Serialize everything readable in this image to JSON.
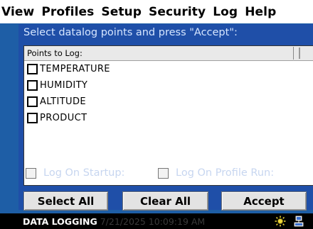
{
  "menu": [
    "View",
    "Profiles",
    "Setup",
    "Security",
    "Log",
    "Help"
  ],
  "prompt": "Select datalog points and press \"Accept\":",
  "list": {
    "header": "Points to Log:",
    "items": [
      {
        "label": "TEMPERATURE",
        "checked": false
      },
      {
        "label": "HUMIDITY",
        "checked": false
      },
      {
        "label": "ALTITUDE",
        "checked": false
      },
      {
        "label": "PRODUCT",
        "checked": false
      }
    ]
  },
  "options": {
    "startup": {
      "label": "Log On Startup:",
      "checked": false
    },
    "profile_run": {
      "label": "Log On Profile Run:",
      "checked": false
    }
  },
  "buttons": {
    "select_all": "Select All",
    "clear_all": "Clear All",
    "accept": "Accept"
  },
  "status": {
    "label": "DATA LOGGING",
    "time": "7/21/2025 10:09:19 AM",
    "icons": [
      "sun-icon",
      "network-icon"
    ]
  },
  "colors": {
    "background": "#1e5ea6",
    "panel": "#1f4fa8",
    "prompt_text": "#d6e6ff"
  }
}
